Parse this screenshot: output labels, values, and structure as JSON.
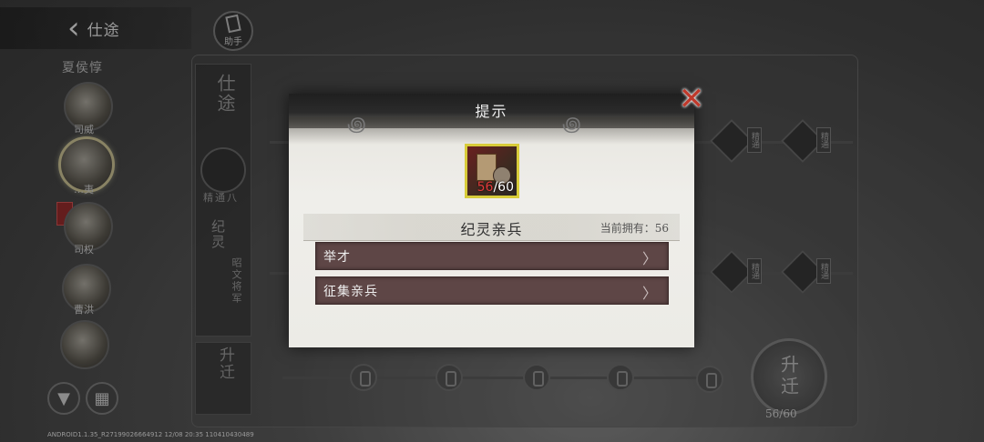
{
  "header": {
    "back_icon": "‹",
    "title": "仕途",
    "assistant_label": "助手"
  },
  "sidebar": {
    "group_title": "夏侯惇",
    "heroes": [
      {
        "name": "司威"
      },
      {
        "name": "…夷"
      },
      {
        "name": "司权"
      },
      {
        "name": "曹洪"
      },
      {
        "name": ""
      }
    ],
    "filter_icon": "▼",
    "grid_icon": "▦"
  },
  "career": {
    "column_title": "仕途",
    "emblem_label": "精通八",
    "rank_title": "纪灵",
    "rank_sub": "昭文将军",
    "promote_col": "升迁",
    "node_label": "精通",
    "promote_button": "升迁",
    "progress": "56/60"
  },
  "dialog": {
    "title": "提示",
    "item": {
      "owned_count": "56",
      "required": "/60"
    },
    "item_name": "纪灵亲兵",
    "owned_text": "当前拥有：56",
    "options": [
      {
        "label": "举才",
        "arrow": "〉"
      },
      {
        "label": "征集亲兵",
        "arrow": "〉"
      }
    ],
    "close_icon": "✕"
  },
  "footer": {
    "version": "ANDROID1.1.35_R27199026664912 12/08 20:35 110410430489"
  },
  "colors": {
    "option_bg": "#5e4646",
    "item_border": "#d8cc3a",
    "close": "#c0392b"
  }
}
